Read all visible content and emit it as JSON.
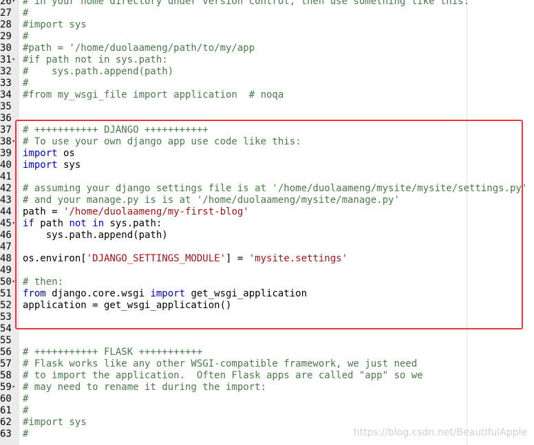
{
  "lines": [
    {
      "n": "26",
      "fold": true,
      "t": [
        {
          "c": "comment",
          "v": "# in your home directory under version control, then use something like this:"
        }
      ]
    },
    {
      "n": "27",
      "fold": false,
      "t": [
        {
          "c": "comment",
          "v": "#"
        }
      ]
    },
    {
      "n": "28",
      "fold": false,
      "t": [
        {
          "c": "comment",
          "v": "#import sys"
        }
      ]
    },
    {
      "n": "29",
      "fold": false,
      "t": [
        {
          "c": "comment",
          "v": "#"
        }
      ]
    },
    {
      "n": "30",
      "fold": false,
      "t": [
        {
          "c": "comment",
          "v": "#path = '/home/duolaameng/path/to/my/app"
        }
      ]
    },
    {
      "n": "31",
      "fold": true,
      "t": [
        {
          "c": "comment",
          "v": "#if path not in sys.path:"
        }
      ]
    },
    {
      "n": "32",
      "fold": false,
      "t": [
        {
          "c": "comment",
          "v": "#    sys.path.append(path)"
        }
      ]
    },
    {
      "n": "33",
      "fold": false,
      "t": [
        {
          "c": "comment",
          "v": "#"
        }
      ]
    },
    {
      "n": "34",
      "fold": false,
      "t": [
        {
          "c": "comment",
          "v": "#from my_wsgi_file import application  # noqa"
        }
      ]
    },
    {
      "n": "35",
      "fold": false,
      "t": []
    },
    {
      "n": "36",
      "fold": false,
      "t": []
    },
    {
      "n": "37",
      "fold": false,
      "t": [
        {
          "c": "comment",
          "v": "# +++++++++++ DJANGO +++++++++++"
        }
      ]
    },
    {
      "n": "38",
      "fold": true,
      "t": [
        {
          "c": "comment",
          "v": "# To use your own django app use code like this:"
        }
      ]
    },
    {
      "n": "39",
      "fold": false,
      "t": [
        {
          "c": "kw",
          "v": "import"
        },
        {
          "c": "plain",
          "v": " os"
        }
      ]
    },
    {
      "n": "40",
      "fold": false,
      "t": [
        {
          "c": "kw",
          "v": "import"
        },
        {
          "c": "plain",
          "v": " sys"
        }
      ]
    },
    {
      "n": "41",
      "fold": false,
      "t": []
    },
    {
      "n": "42",
      "fold": false,
      "t": [
        {
          "c": "comment",
          "v": "# assuming your django settings file is at '/home/duolaameng/mysite/mysite/settings.py'"
        }
      ]
    },
    {
      "n": "43",
      "fold": false,
      "t": [
        {
          "c": "comment",
          "v": "# and your manage.py is is at '/home/duolaameng/mysite/manage.py'"
        }
      ]
    },
    {
      "n": "44",
      "fold": false,
      "t": [
        {
          "c": "plain",
          "v": "path = "
        },
        {
          "c": "str",
          "v": "'/home/duolaameng/my-first-blog'"
        }
      ]
    },
    {
      "n": "45",
      "fold": true,
      "t": [
        {
          "c": "kw",
          "v": "if"
        },
        {
          "c": "plain",
          "v": " path "
        },
        {
          "c": "kw",
          "v": "not"
        },
        {
          "c": "plain",
          "v": " "
        },
        {
          "c": "kw",
          "v": "in"
        },
        {
          "c": "plain",
          "v": " sys.path:"
        }
      ]
    },
    {
      "n": "46",
      "fold": false,
      "t": [
        {
          "c": "plain",
          "v": "    sys.path.append(path)"
        }
      ]
    },
    {
      "n": "47",
      "fold": false,
      "t": []
    },
    {
      "n": "48",
      "fold": false,
      "t": [
        {
          "c": "plain",
          "v": "os.environ["
        },
        {
          "c": "str",
          "v": "'DJANGO_SETTINGS_MODULE'"
        },
        {
          "c": "plain",
          "v": "] = "
        },
        {
          "c": "str",
          "v": "'mysite.settings'"
        }
      ]
    },
    {
      "n": "49",
      "fold": false,
      "t": []
    },
    {
      "n": "50",
      "fold": true,
      "t": [
        {
          "c": "comment",
          "v": "# then:"
        }
      ]
    },
    {
      "n": "51",
      "fold": false,
      "t": [
        {
          "c": "kw",
          "v": "from"
        },
        {
          "c": "plain",
          "v": " django.core.wsgi "
        },
        {
          "c": "kw",
          "v": "import"
        },
        {
          "c": "plain",
          "v": " get_wsgi_application"
        }
      ]
    },
    {
      "n": "52",
      "fold": false,
      "t": [
        {
          "c": "plain",
          "v": "application = get_wsgi_application()"
        }
      ]
    },
    {
      "n": "53",
      "fold": false,
      "t": []
    },
    {
      "n": "54",
      "fold": false,
      "t": []
    },
    {
      "n": "55",
      "fold": false,
      "t": []
    },
    {
      "n": "56",
      "fold": false,
      "t": [
        {
          "c": "comment",
          "v": "# +++++++++++ FLASK +++++++++++"
        }
      ]
    },
    {
      "n": "57",
      "fold": false,
      "t": [
        {
          "c": "comment",
          "v": "# Flask works like any other WSGI-compatible framework, we just need"
        }
      ]
    },
    {
      "n": "58",
      "fold": false,
      "t": [
        {
          "c": "comment",
          "v": "# to import the application.  Often Flask apps are called \"app\" so we"
        }
      ]
    },
    {
      "n": "59",
      "fold": true,
      "t": [
        {
          "c": "comment",
          "v": "# may need to rename it during the import:"
        }
      ]
    },
    {
      "n": "60",
      "fold": false,
      "t": [
        {
          "c": "comment",
          "v": "#"
        }
      ]
    },
    {
      "n": "61",
      "fold": false,
      "t": [
        {
          "c": "comment",
          "v": "#"
        }
      ]
    },
    {
      "n": "62",
      "fold": false,
      "t": [
        {
          "c": "comment",
          "v": "#import sys"
        }
      ]
    },
    {
      "n": "63",
      "fold": false,
      "t": [
        {
          "c": "comment",
          "v": "#"
        }
      ]
    }
  ],
  "fold_glyph": "▾",
  "watermark": "https://blog.csdn.net/BeautifulApple"
}
